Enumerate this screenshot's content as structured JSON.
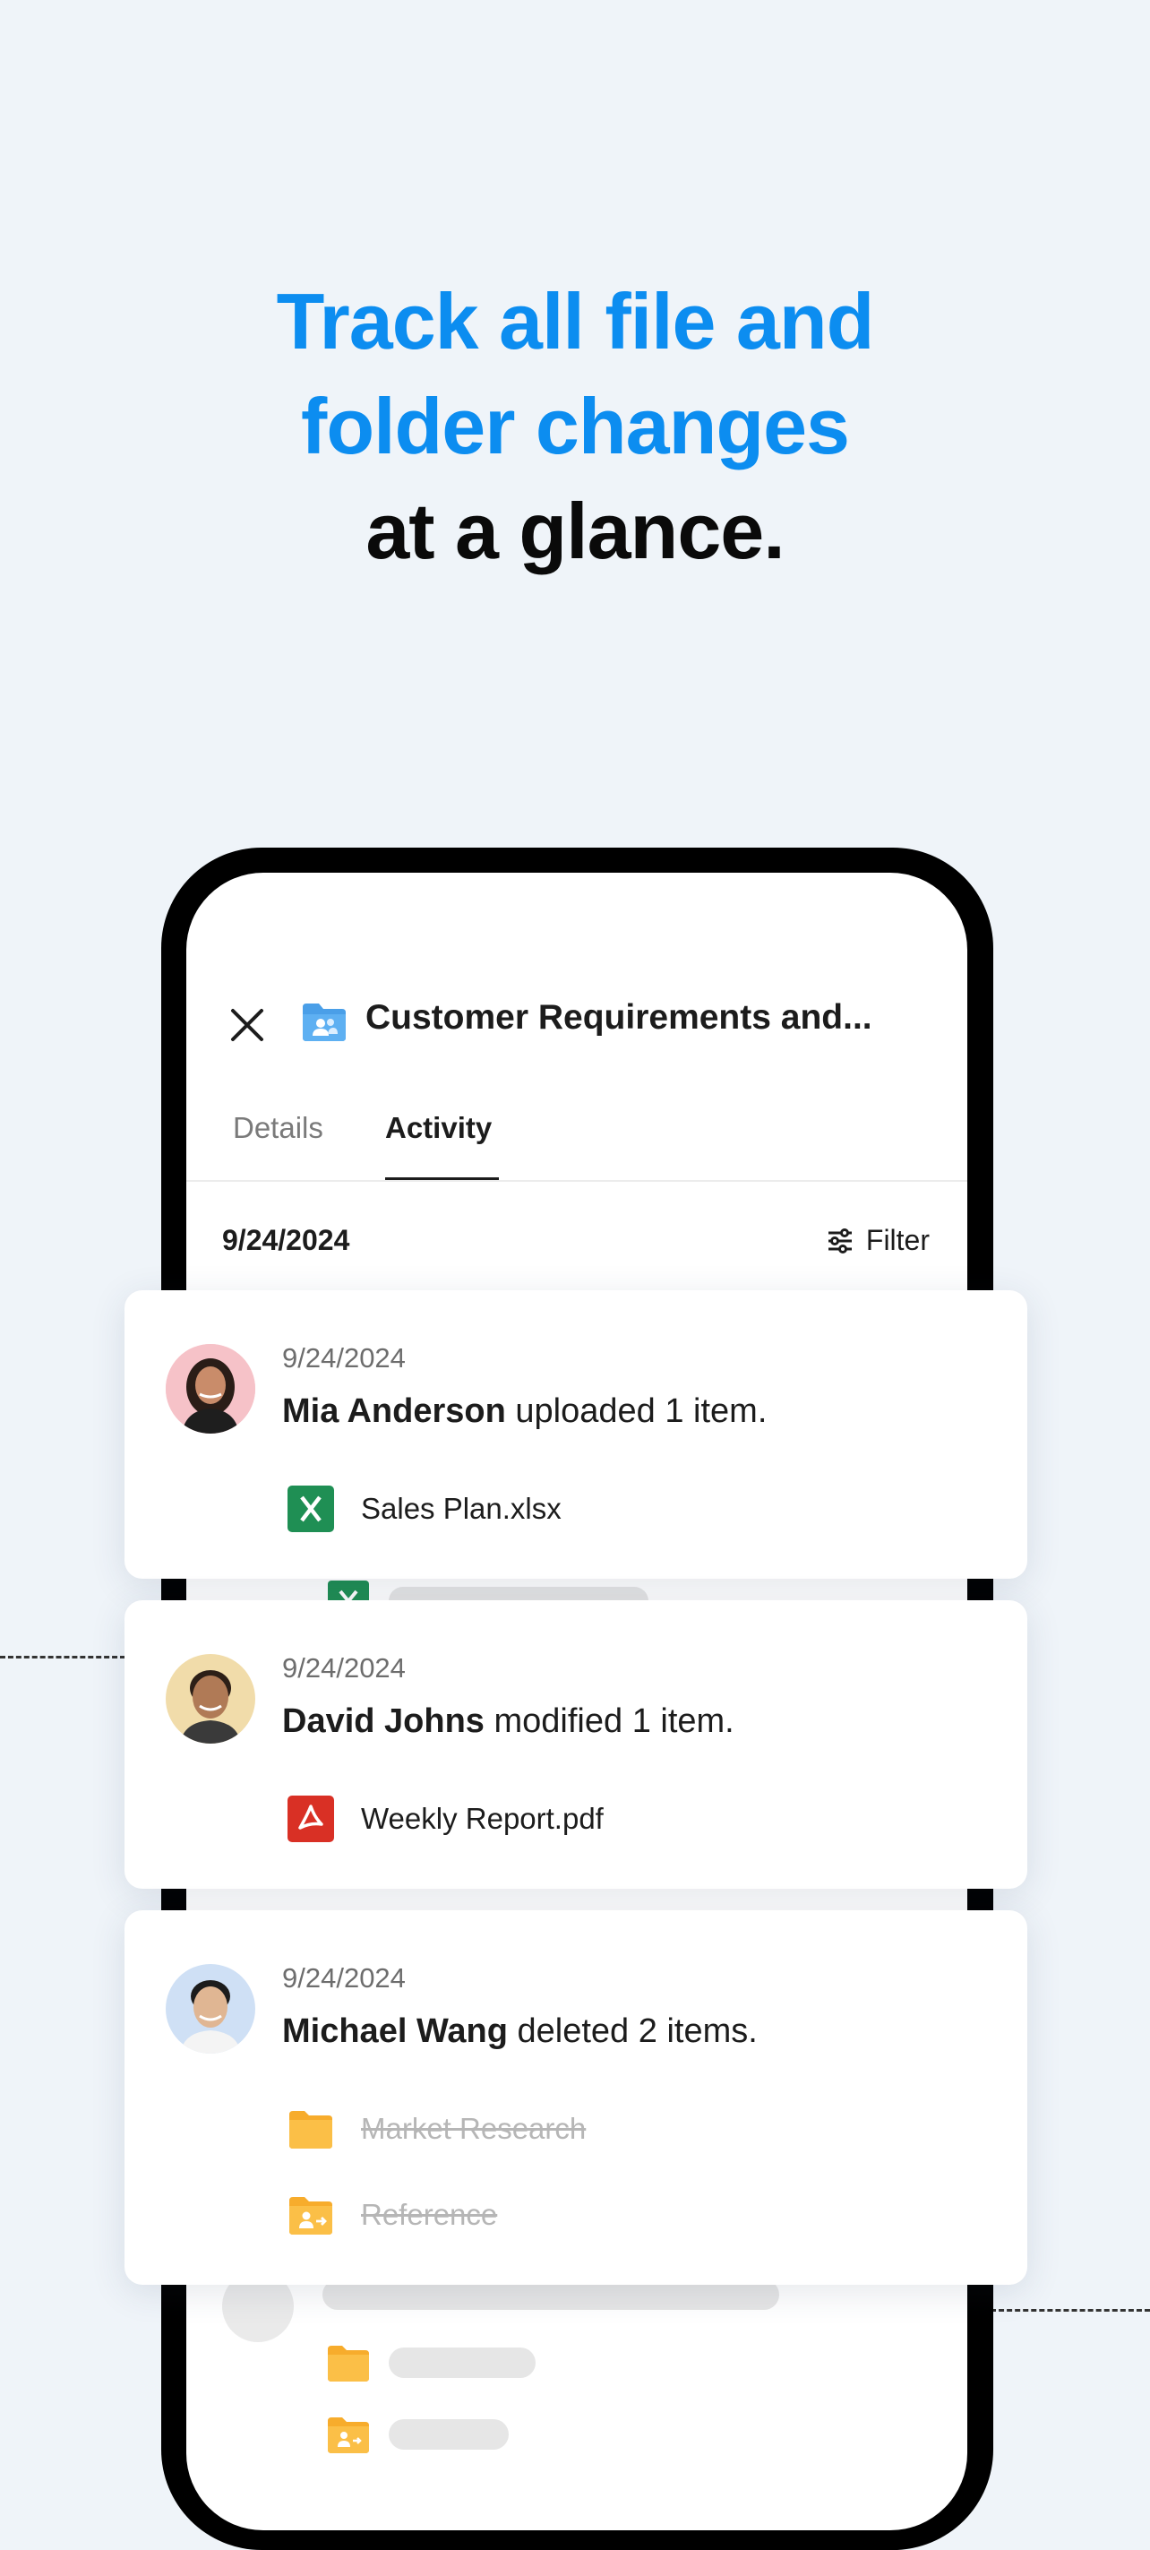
{
  "headline": {
    "line1": "Track all file and",
    "line2": "folder changes",
    "line3": "at a glance."
  },
  "panel": {
    "title": "Customer Requirements and...",
    "tabs": [
      "Details",
      "Activity"
    ],
    "active_tab": "Activity",
    "date": "9/24/2024",
    "filter_label": "Filter"
  },
  "activities": [
    {
      "date": "9/24/2024",
      "user": "Mia Anderson",
      "action": " uploaded 1 item.",
      "files": [
        {
          "name": "Sales Plan.xlsx",
          "icon": "excel-icon",
          "deleted": false
        }
      ]
    },
    {
      "date": "9/24/2024",
      "user": "David Johns",
      "action": " modified 1 item.",
      "files": [
        {
          "name": "Weekly Report.pdf",
          "icon": "pdf-icon",
          "deleted": false
        }
      ]
    },
    {
      "date": "9/24/2024",
      "user": "Michael Wang",
      "action": " deleted 2 items.",
      "files": [
        {
          "name": "Market Research",
          "icon": "folder-icon",
          "deleted": true
        },
        {
          "name": "Reference",
          "icon": "shared-folder-icon",
          "deleted": true
        }
      ]
    }
  ],
  "colors": {
    "background": "#eff4f9",
    "accent_blue": "#0c8df0",
    "excel_green": "#1f8f54",
    "pdf_red": "#d93025",
    "folder_yellow": "#fbbf47"
  }
}
